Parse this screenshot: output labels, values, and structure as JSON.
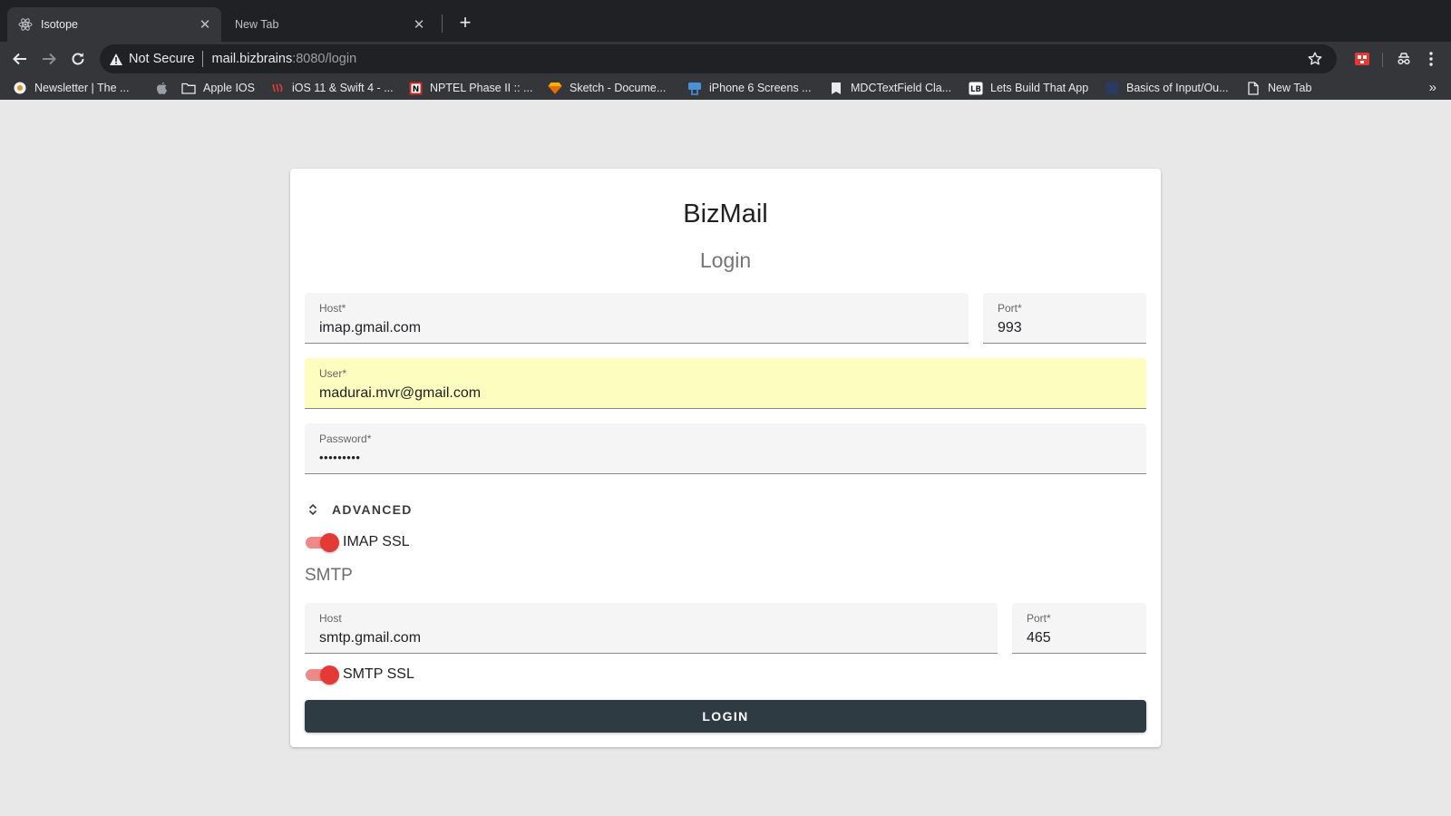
{
  "browser": {
    "tabs": [
      {
        "title": "Isotope",
        "icon": "react-atom-icon",
        "active": true
      },
      {
        "title": "New Tab",
        "active": false
      }
    ],
    "address": {
      "security_label": "Not Secure",
      "host": "mail.bizbrains",
      "path": ":8080/login"
    },
    "bookmarks": [
      {
        "label": "Newsletter | The ...",
        "icon": "newsletter-favicon-icon"
      },
      {
        "label": "",
        "icon": "apple-icon"
      },
      {
        "label": "Apple IOS",
        "icon": "folder-icon"
      },
      {
        "label": "iOS 11 & Swift 4 - ...",
        "icon": "udemy-icon"
      },
      {
        "label": "NPTEL Phase II :: ...",
        "icon": "nptel-icon"
      },
      {
        "label": "Sketch - Docume...",
        "icon": "sketch-icon"
      },
      {
        "label": "iPhone 6 Screens ...",
        "icon": "paintcode-icon"
      },
      {
        "label": "MDCTextField Cla...",
        "icon": "mdc-icon"
      },
      {
        "label": "Lets Build That App",
        "icon": "lbta-icon"
      },
      {
        "label": "Basics of Input/Ou...",
        "icon": "site-favicon-icon"
      },
      {
        "label": "New Tab",
        "icon": "page-icon"
      }
    ]
  },
  "login": {
    "brand": "BizMail",
    "subtitle": "Login",
    "imap_host": {
      "label": "Host*",
      "value": "imap.gmail.com"
    },
    "imap_port": {
      "label": "Port*",
      "value": "993"
    },
    "user": {
      "label": "User*",
      "value": "madurai.mvr@gmail.com"
    },
    "password": {
      "label": "Password*",
      "value": "•••••••••"
    },
    "advanced_label": "ADVANCED",
    "imap_ssl": {
      "label": "IMAP SSL",
      "on": true
    },
    "smtp_section": "SMTP",
    "smtp_host": {
      "label": "Host",
      "value": "smtp.gmail.com"
    },
    "smtp_port": {
      "label": "Port*",
      "value": "465"
    },
    "smtp_ssl": {
      "label": "SMTP SSL",
      "on": true
    },
    "submit_label": "LOGIN"
  },
  "colors": {
    "primary_button": "#2e3b43",
    "switch_on": "#e53935",
    "autofill_bg": "#fdfdc0",
    "page_bg": "#e8e8e8"
  }
}
